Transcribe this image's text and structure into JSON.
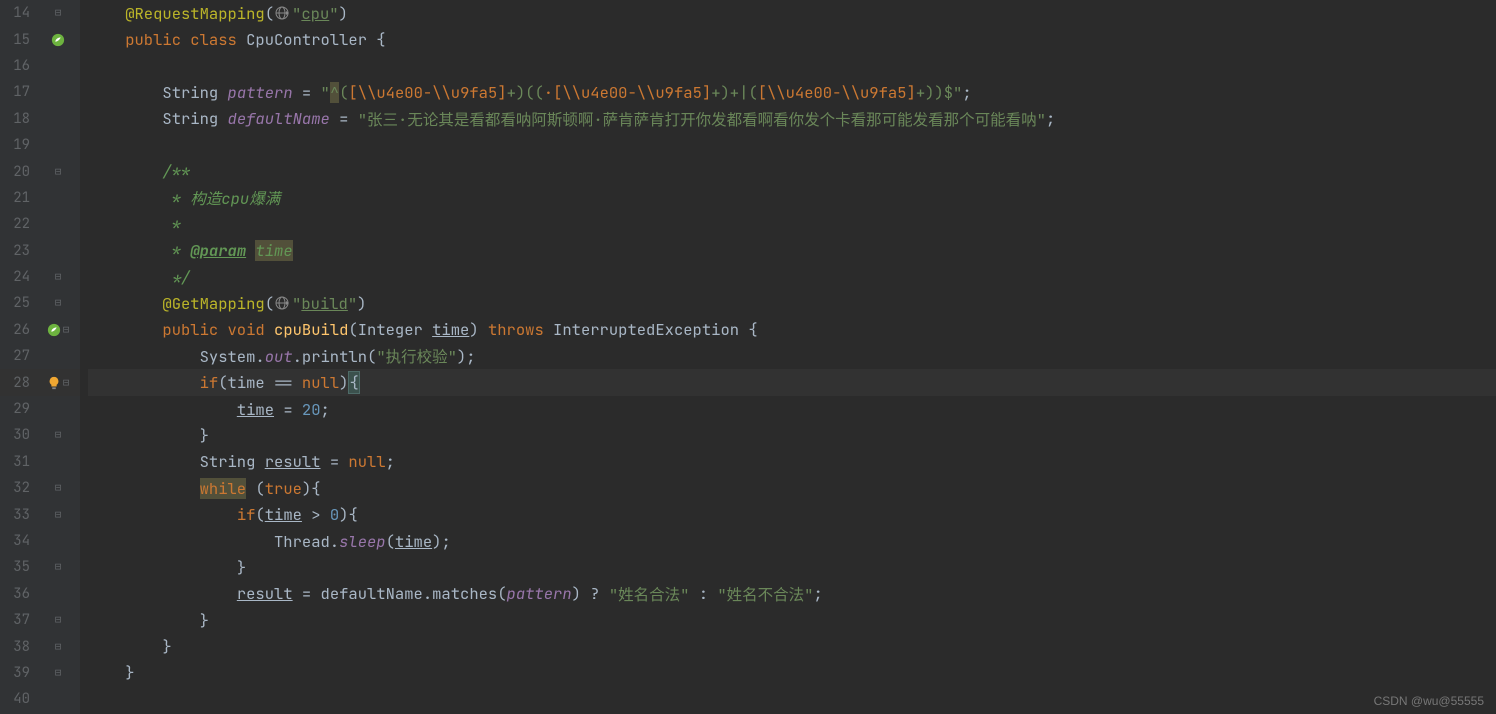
{
  "watermark": "CSDN @wu@55555",
  "lines": [
    {
      "num": "14",
      "icons": [
        "fold-minus"
      ],
      "segments": [
        {
          "cls": "plain",
          "t": "    "
        },
        {
          "cls": "annotation",
          "t": "@RequestMapping"
        },
        {
          "cls": "plain",
          "t": "("
        },
        {
          "cls": "globe",
          "t": ""
        },
        {
          "cls": "string",
          "t": "\""
        },
        {
          "cls": "link-str",
          "t": "cpu"
        },
        {
          "cls": "string",
          "t": "\""
        },
        {
          "cls": "plain",
          "t": ")"
        }
      ]
    },
    {
      "num": "15",
      "icons": [
        "spring"
      ],
      "segments": [
        {
          "cls": "plain",
          "t": "    "
        },
        {
          "cls": "kw",
          "t": "public class "
        },
        {
          "cls": "plain",
          "t": "CpuController {"
        }
      ]
    },
    {
      "num": "16",
      "segments": []
    },
    {
      "num": "17",
      "segments": [
        {
          "cls": "plain",
          "t": "        String "
        },
        {
          "cls": "field",
          "t": "pattern"
        },
        {
          "cls": "plain",
          "t": " = "
        },
        {
          "cls": "string",
          "t": "\""
        },
        {
          "cls": "warn-bg string",
          "t": "^"
        },
        {
          "cls": "string",
          "t": "("
        },
        {
          "cls": "string-esc",
          "t": "[\\\\u4e00-\\\\u9fa5]"
        },
        {
          "cls": "string",
          "t": "+)(("
        },
        {
          "cls": "string-esc",
          "t": "·[\\\\u4e00-\\\\u9fa5]"
        },
        {
          "cls": "string",
          "t": "+)+|("
        },
        {
          "cls": "string-esc",
          "t": "[\\\\u4e00-\\\\u9fa5]"
        },
        {
          "cls": "string",
          "t": "+))$\""
        },
        {
          "cls": "plain",
          "t": ";"
        }
      ]
    },
    {
      "num": "18",
      "segments": [
        {
          "cls": "plain",
          "t": "        String "
        },
        {
          "cls": "field",
          "t": "defaultName"
        },
        {
          "cls": "plain",
          "t": " = "
        },
        {
          "cls": "string",
          "t": "\"张三·无论其是看都看呐阿斯顿啊·萨肯萨肯打开你发都看啊看你发个卡看那可能发看那个可能看呐\""
        },
        {
          "cls": "plain",
          "t": ";"
        }
      ]
    },
    {
      "num": "19",
      "segments": []
    },
    {
      "num": "20",
      "icons": [
        "fold-minus"
      ],
      "segments": [
        {
          "cls": "plain",
          "t": "        "
        },
        {
          "cls": "comment-doc",
          "t": "/**"
        }
      ]
    },
    {
      "num": "21",
      "segments": [
        {
          "cls": "plain",
          "t": "         "
        },
        {
          "cls": "comment-doc",
          "t": "* 构造cpu爆满"
        }
      ]
    },
    {
      "num": "22",
      "segments": [
        {
          "cls": "plain",
          "t": "         "
        },
        {
          "cls": "comment-doc",
          "t": "*"
        }
      ]
    },
    {
      "num": "23",
      "segments": [
        {
          "cls": "plain",
          "t": "         "
        },
        {
          "cls": "comment-doc",
          "t": "* "
        },
        {
          "cls": "comment-tag",
          "t": "@param"
        },
        {
          "cls": "comment-doc",
          "t": " "
        },
        {
          "cls": "warn-bg comment-doc",
          "t": "time"
        }
      ]
    },
    {
      "num": "24",
      "icons": [
        "fold-close"
      ],
      "segments": [
        {
          "cls": "plain",
          "t": "         "
        },
        {
          "cls": "comment-doc",
          "t": "*/"
        }
      ]
    },
    {
      "num": "25",
      "icons": [
        "fold-minus"
      ],
      "segments": [
        {
          "cls": "plain",
          "t": "        "
        },
        {
          "cls": "annotation",
          "t": "@GetMapping"
        },
        {
          "cls": "plain",
          "t": "("
        },
        {
          "cls": "globe",
          "t": ""
        },
        {
          "cls": "string",
          "t": "\""
        },
        {
          "cls": "link-str",
          "t": "build"
        },
        {
          "cls": "string",
          "t": "\""
        },
        {
          "cls": "plain",
          "t": ")"
        }
      ]
    },
    {
      "num": "26",
      "icons": [
        "spring",
        "fold-minus"
      ],
      "segments": [
        {
          "cls": "plain",
          "t": "        "
        },
        {
          "cls": "kw",
          "t": "public void "
        },
        {
          "cls": "method",
          "t": "cpuBuild"
        },
        {
          "cls": "plain",
          "t": "(Integer "
        },
        {
          "cls": "param",
          "t": "time"
        },
        {
          "cls": "plain",
          "t": ") "
        },
        {
          "cls": "kw",
          "t": "throws "
        },
        {
          "cls": "plain",
          "t": "InterruptedException {"
        }
      ]
    },
    {
      "num": "27",
      "segments": [
        {
          "cls": "plain",
          "t": "            System."
        },
        {
          "cls": "static-field",
          "t": "out"
        },
        {
          "cls": "plain",
          "t": ".println("
        },
        {
          "cls": "string",
          "t": "\"执行校验\""
        },
        {
          "cls": "plain",
          "t": ");"
        }
      ]
    },
    {
      "num": "28",
      "current": true,
      "icons": [
        "bulb",
        "fold-minus"
      ],
      "segments": [
        {
          "cls": "plain",
          "t": "            "
        },
        {
          "cls": "kw",
          "t": "if"
        },
        {
          "cls": "plain",
          "t": "(time == "
        },
        {
          "cls": "kw",
          "t": "null"
        },
        {
          "cls": "plain",
          "t": ")"
        },
        {
          "cls": "paren-match plain",
          "t": "{"
        }
      ]
    },
    {
      "num": "29",
      "segments": [
        {
          "cls": "plain",
          "t": "                "
        },
        {
          "cls": "param",
          "t": "time"
        },
        {
          "cls": "plain",
          "t": " = "
        },
        {
          "cls": "num",
          "t": "20"
        },
        {
          "cls": "plain",
          "t": ";"
        }
      ]
    },
    {
      "num": "30",
      "icons": [
        "fold-close"
      ],
      "segments": [
        {
          "cls": "plain",
          "t": "            "
        },
        {
          "cls": "plain",
          "t": "}"
        }
      ]
    },
    {
      "num": "31",
      "segments": [
        {
          "cls": "plain",
          "t": "            String "
        },
        {
          "cls": "param",
          "t": "result"
        },
        {
          "cls": "plain",
          "t": " = "
        },
        {
          "cls": "kw",
          "t": "null"
        },
        {
          "cls": "plain",
          "t": ";"
        }
      ]
    },
    {
      "num": "32",
      "icons": [
        "fold-minus"
      ],
      "segments": [
        {
          "cls": "plain",
          "t": "            "
        },
        {
          "cls": "warn-bg kw",
          "t": "while"
        },
        {
          "cls": "plain",
          "t": " ("
        },
        {
          "cls": "kw",
          "t": "true"
        },
        {
          "cls": "plain",
          "t": "){"
        }
      ]
    },
    {
      "num": "33",
      "icons": [
        "fold-minus"
      ],
      "segments": [
        {
          "cls": "plain",
          "t": "                "
        },
        {
          "cls": "kw",
          "t": "if"
        },
        {
          "cls": "plain",
          "t": "("
        },
        {
          "cls": "param",
          "t": "time"
        },
        {
          "cls": "plain",
          "t": " > "
        },
        {
          "cls": "num",
          "t": "0"
        },
        {
          "cls": "plain",
          "t": "){"
        }
      ]
    },
    {
      "num": "34",
      "segments": [
        {
          "cls": "plain",
          "t": "                    Thread."
        },
        {
          "cls": "static-field",
          "t": "sleep"
        },
        {
          "cls": "plain",
          "t": "("
        },
        {
          "cls": "param",
          "t": "time"
        },
        {
          "cls": "plain",
          "t": ");"
        }
      ]
    },
    {
      "num": "35",
      "icons": [
        "fold-close"
      ],
      "segments": [
        {
          "cls": "plain",
          "t": "                "
        },
        {
          "cls": "plain",
          "t": "}"
        }
      ]
    },
    {
      "num": "36",
      "segments": [
        {
          "cls": "plain",
          "t": "                "
        },
        {
          "cls": "param",
          "t": "result"
        },
        {
          "cls": "plain",
          "t": " = defaultName.matches("
        },
        {
          "cls": "field",
          "t": "pattern"
        },
        {
          "cls": "plain",
          "t": ") ? "
        },
        {
          "cls": "string",
          "t": "\"姓名合法\""
        },
        {
          "cls": "plain",
          "t": " : "
        },
        {
          "cls": "string",
          "t": "\"姓名不合法\""
        },
        {
          "cls": "plain",
          "t": ";"
        }
      ]
    },
    {
      "num": "37",
      "icons": [
        "fold-close"
      ],
      "segments": [
        {
          "cls": "plain",
          "t": "            "
        },
        {
          "cls": "plain",
          "t": "}"
        }
      ]
    },
    {
      "num": "38",
      "icons": [
        "fold-close"
      ],
      "segments": [
        {
          "cls": "plain",
          "t": "        "
        },
        {
          "cls": "plain",
          "t": "}"
        }
      ]
    },
    {
      "num": "39",
      "icons": [
        "fold-close"
      ],
      "segments": [
        {
          "cls": "plain",
          "t": "    "
        },
        {
          "cls": "plain",
          "t": "}"
        }
      ]
    },
    {
      "num": "40",
      "segments": []
    }
  ]
}
